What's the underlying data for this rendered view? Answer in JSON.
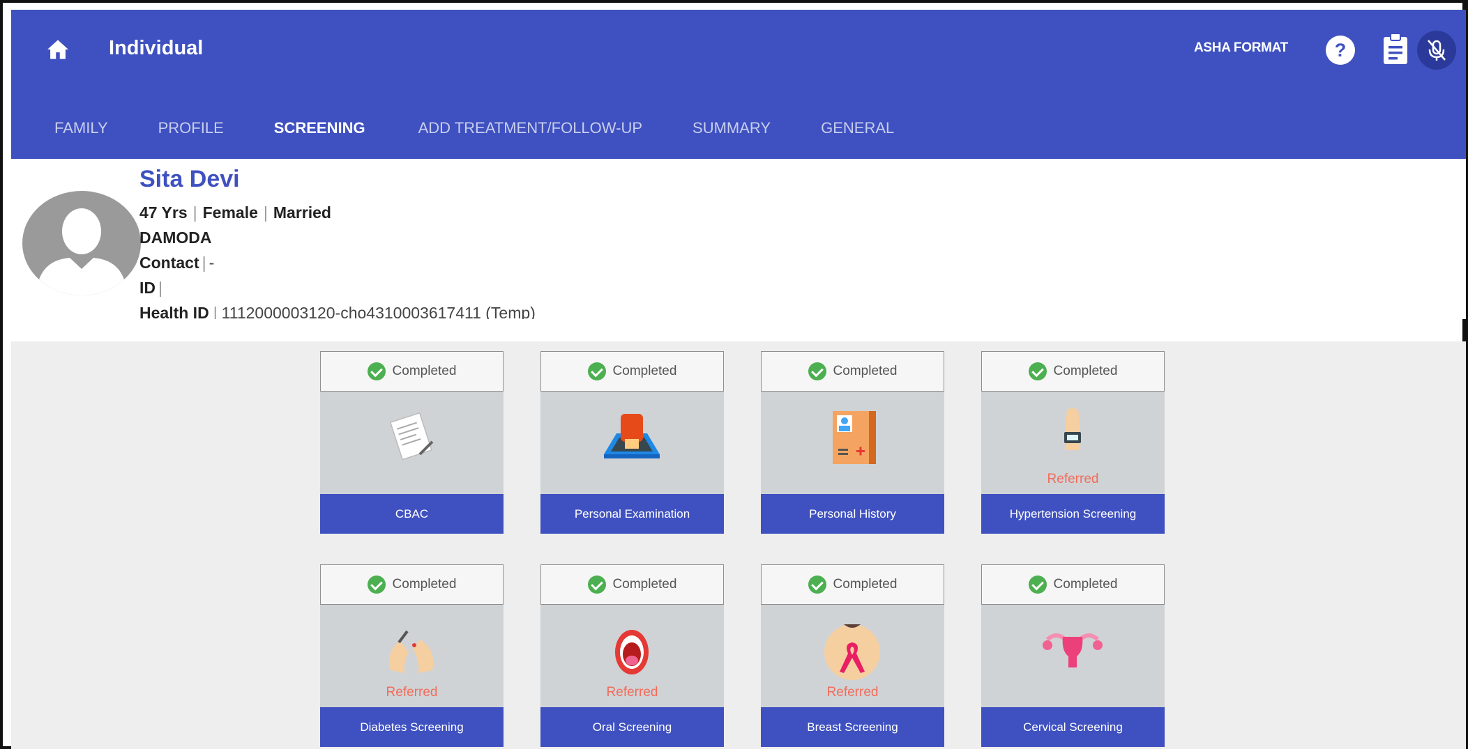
{
  "header": {
    "title": "Individual",
    "asha_format": "ASHA FORMAT"
  },
  "tabs": [
    {
      "label": "FAMILY",
      "active": false
    },
    {
      "label": "PROFILE",
      "active": false
    },
    {
      "label": "SCREENING",
      "active": true
    },
    {
      "label": "ADD TREATMENT/FOLLOW-UP",
      "active": false
    },
    {
      "label": "SUMMARY",
      "active": false
    },
    {
      "label": "GENERAL",
      "active": false
    }
  ],
  "profile": {
    "name": "Sita Devi",
    "age": "47 Yrs",
    "gender": "Female",
    "marital_status": "Married",
    "village": "DAMODA",
    "contact_label": "Contact",
    "contact_value": "-",
    "id_label": "ID",
    "id_value": "",
    "health_id_label": "Health ID",
    "health_id_value": "1112000003120-cho4310003617411 (Temp)"
  },
  "cards": [
    {
      "status": "Completed",
      "label": "CBAC",
      "referred": "",
      "icon": "form-icon"
    },
    {
      "status": "Completed",
      "label": "Personal Examination",
      "referred": "",
      "icon": "examination-icon"
    },
    {
      "status": "Completed",
      "label": "Personal History",
      "referred": "",
      "icon": "medical-record-icon"
    },
    {
      "status": "Completed",
      "label": "Hypertension Screening",
      "referred": "Referred",
      "icon": "bp-monitor-icon"
    },
    {
      "status": "Completed",
      "label": "Diabetes Screening",
      "referred": "Referred",
      "icon": "glucose-test-icon"
    },
    {
      "status": "Completed",
      "label": "Oral Screening",
      "referred": "Referred",
      "icon": "mouth-icon"
    },
    {
      "status": "Completed",
      "label": "Breast Screening",
      "referred": "Referred",
      "icon": "pink-ribbon-icon"
    },
    {
      "status": "Completed",
      "label": "Cervical Screening",
      "referred": "",
      "icon": "uterus-icon"
    }
  ],
  "colors": {
    "primary": "#3f51c0",
    "completed": "#4caf50",
    "referred": "#f26c5a"
  }
}
